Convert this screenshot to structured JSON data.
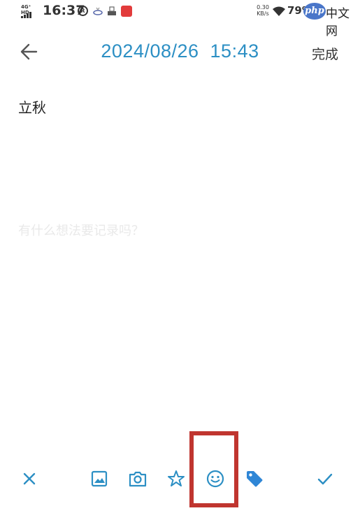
{
  "status_bar": {
    "network": "4G⁺ HD",
    "time": "16:37",
    "app_icon_r": "R",
    "net_speed_value": "0.30",
    "net_speed_unit": "KB/s",
    "battery": "79%",
    "watermark_logo": "php",
    "watermark_text": "中文网"
  },
  "header": {
    "back_icon": "arrow-left-icon",
    "date": "2024/08/26",
    "time": "15:43",
    "done_label": "完成"
  },
  "note": {
    "title": "立秋",
    "body_placeholder": "有什么想法要记录吗？"
  },
  "toolbar": {
    "items": [
      {
        "icon": "close-icon"
      },
      {
        "icon": "image-icon"
      },
      {
        "icon": "camera-icon"
      },
      {
        "icon": "star-icon"
      },
      {
        "icon": "emoji-icon"
      },
      {
        "icon": "tag-icon"
      },
      {
        "icon": "check-icon"
      }
    ]
  },
  "colors": {
    "accent": "#2c8fc4",
    "highlight": "#c0352f",
    "tag": "#2f86d6"
  }
}
